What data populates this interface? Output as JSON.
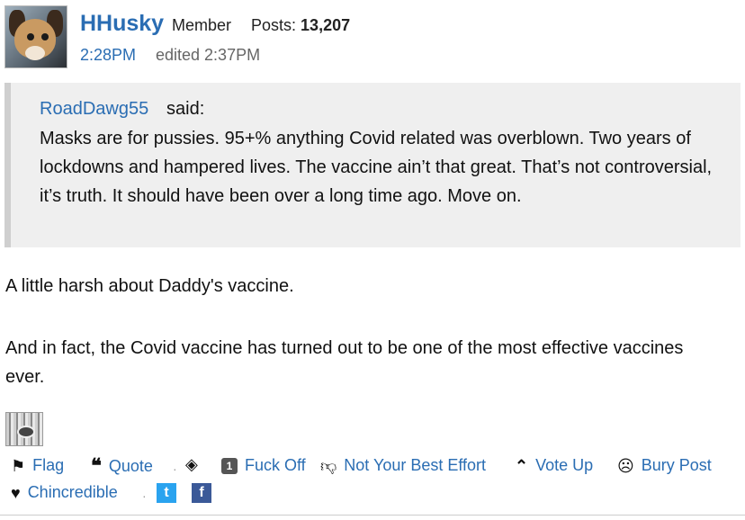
{
  "post": {
    "author": "HHusky",
    "role": "Member",
    "posts_label": "Posts:",
    "posts_count": "13,207",
    "time": "2:28PM",
    "edited": "edited 2:37PM"
  },
  "quote": {
    "author": "RoadDawg55",
    "said": "said:",
    "text": "Masks are for pussies. 95+% anything Covid related was overblown. Two years of lockdowns and hampered lives. The vaccine ain’t that great. That’s not controversial, it’s truth. It should have been over a long time ago. Move on."
  },
  "body": {
    "line1": "A little harsh about Daddy's vaccine.",
    "line2": "And in fact, the Covid vaccine has turned out to be one of the most effective vaccines ever."
  },
  "reactions": {
    "flag": "Flag",
    "quote": "Quote",
    "separator": "·",
    "fuckoff_count": "1",
    "fuckoff": "Fuck Off",
    "not_best": "Not Your Best Effort",
    "vote_up": "Vote Up",
    "bury": "Bury Post",
    "chincredible": "Chincredible",
    "twitter_glyph": "t",
    "facebook_glyph": "f"
  },
  "icons": {
    "flag": "flag-icon",
    "quote": "quote-icon",
    "hidden": "eye-slash-icon",
    "thumbs_down": "thumbs-down-icon",
    "chevron_up": "chevron-up-icon",
    "bury": "skull-icon",
    "heart": "heart-icon",
    "twitter": "twitter-icon",
    "facebook": "facebook-icon"
  },
  "colors": {
    "link": "#2a6db3",
    "quote_bg": "#efefef",
    "twitter": "#2aa3ef",
    "facebook": "#3b5998"
  }
}
